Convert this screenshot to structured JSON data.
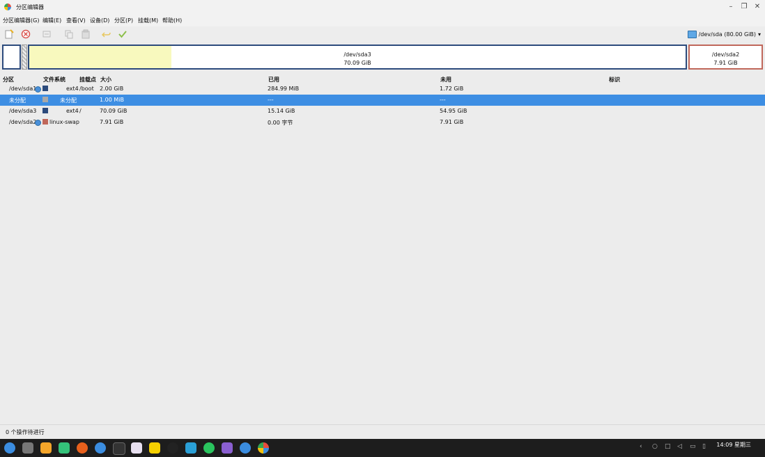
{
  "window": {
    "title": "分区编辑器"
  },
  "menu": [
    "分区编辑器(G)",
    "编辑(E)",
    "查看(V)",
    "设备(D)",
    "分区(P)",
    "挂载(M)",
    "帮助(H)"
  ],
  "toolbar": {
    "icons": [
      "new-icon",
      "delete-icon",
      "resize-icon",
      "copy-icon",
      "paste-icon",
      "undo-icon",
      "apply-icon"
    ],
    "device": "/dev/sda (80.00 GiB)"
  },
  "diskmap": {
    "sda3": {
      "name": "/dev/sda3",
      "size": "70.09 GiB"
    },
    "sda2": {
      "name": "/dev/sda2",
      "size": "7.91 GiB"
    }
  },
  "columns": {
    "partition": "分区",
    "filesystem": "文件系统",
    "mount": "挂载点",
    "size": "大小",
    "used": "已用",
    "unused": "未用",
    "flags": "标识"
  },
  "rows": [
    {
      "partition": "/dev/sda1",
      "filesystem": "ext4",
      "mount": "/boot",
      "size": "2.00 GiB",
      "used": "284.99 MiB",
      "unused": "1.72 GiB",
      "color": "#2c4a7c"
    },
    {
      "partition": "未分配",
      "filesystem": "未分配",
      "mount": "",
      "size": "1.00 MiB",
      "used": "---",
      "unused": "---",
      "color": "#a9a9a9"
    },
    {
      "partition": "/dev/sda3",
      "filesystem": "ext4",
      "mount": "/",
      "size": "70.09 GiB",
      "used": "15.14 GiB",
      "unused": "54.95 GiB",
      "color": "#2c4a7c"
    },
    {
      "partition": "/dev/sda2",
      "filesystem": "linux-swap",
      "mount": "",
      "size": "7.91 GiB",
      "used": "0.00 字节",
      "unused": "7.91 GiB",
      "color": "#c0675a"
    }
  ],
  "status": "0 个操作待进行",
  "clock": {
    "time": "14:09 星期三"
  }
}
